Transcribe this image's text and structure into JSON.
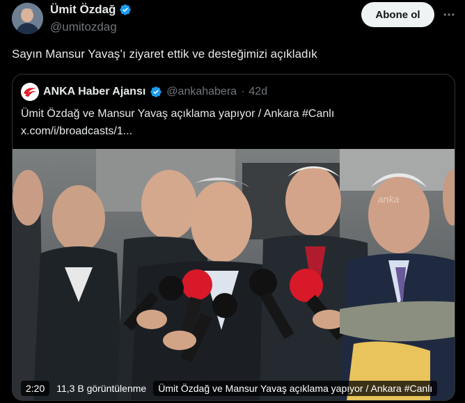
{
  "tweet": {
    "author_name": "Ümit Özdağ",
    "author_handle": "@umitozdag",
    "follow_label": "Abone ol",
    "more_icon": "more-icon",
    "text": "Sayın Mansur Yavaş’ı ziyaret ettik ve desteğimizi açıkladık"
  },
  "quote": {
    "author_name": "ANKA Haber Ajansı",
    "author_handle": "@ankahabera",
    "dot": "·",
    "time": "42d",
    "text_line1": "Ümit Özdağ ve Mansur Yavaş açıklama yapıyor / Ankara #Canlı",
    "text_line2": "x.com/i/broadcasts/1..."
  },
  "media": {
    "watermark": "anka",
    "duration": "2:20",
    "views": "11,3 B görüntülenme",
    "title": "Ümit Özdağ ve Mansur Yavaş açıklama yapıyor / Ankara #Canlı"
  },
  "colors": {
    "verified": "#1d9bf0",
    "background": "#000000",
    "muted": "#71767b"
  }
}
